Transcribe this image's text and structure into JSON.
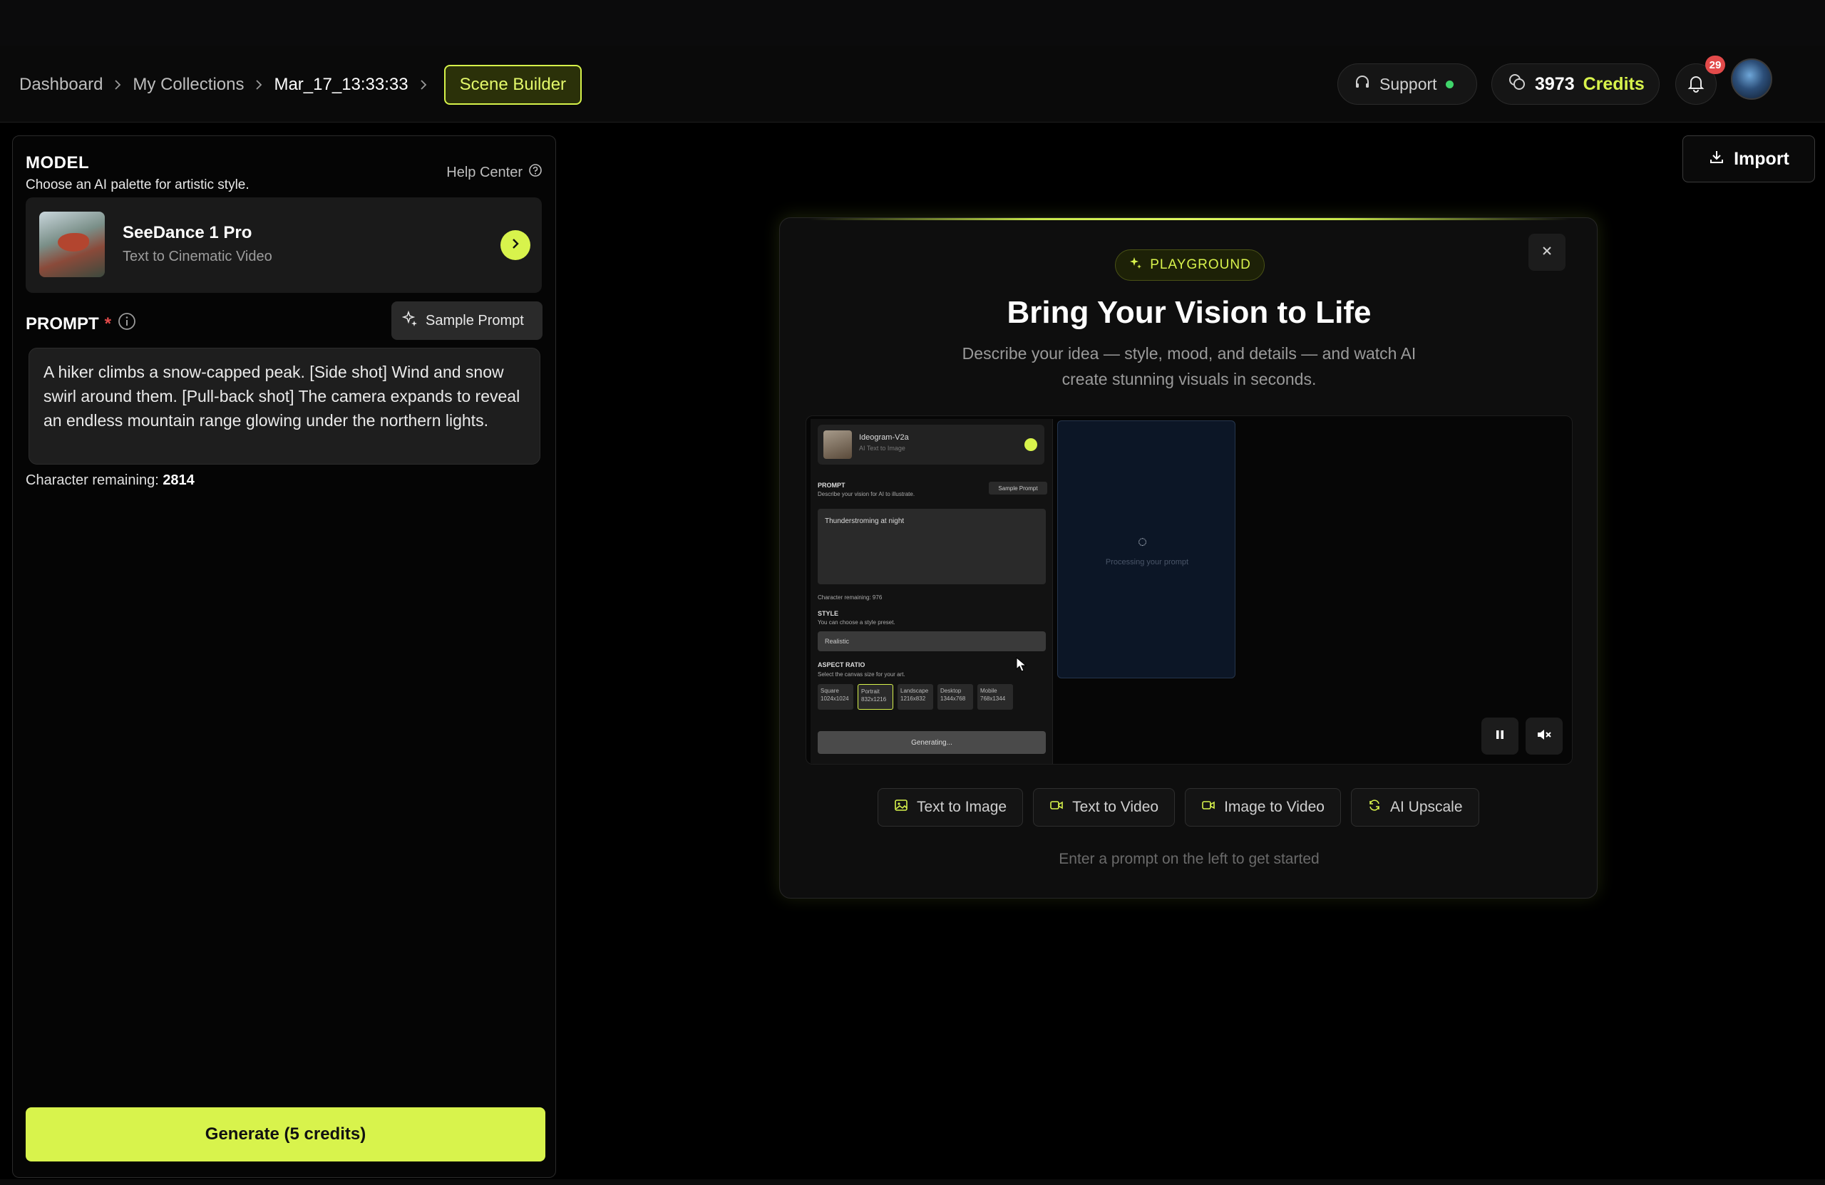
{
  "breadcrumb": {
    "items": [
      "Dashboard",
      "My Collections",
      "Mar_17_13:33:33"
    ],
    "scene_builder": "Scene Builder"
  },
  "header": {
    "support_label": "Support",
    "credits_value": "3973",
    "credits_word": "Credits",
    "notification_count": "29"
  },
  "model": {
    "title": "MODEL",
    "subtitle": "Choose an AI palette for artistic style.",
    "help_label": "Help Center",
    "name": "SeeDance 1 Pro",
    "description": "Text to Cinematic Video"
  },
  "prompt": {
    "title": "PROMPT",
    "required_mark": "*",
    "sample_label": "Sample Prompt",
    "value": "A hiker climbs a snow-capped peak. [Side shot] Wind and snow swirl around them. [Pull-back shot] The camera expands to reveal an endless mountain range glowing under the northern lights.",
    "chars_label": "Character remaining:",
    "chars_value": "2814"
  },
  "generate_label": "Generate (5 credits)",
  "import_label": "Import",
  "playground": {
    "badge": "PLAYGROUND",
    "title": "Bring Your Vision to Life",
    "subtitle": "Describe your idea — style, mood, and details — and watch AI create stunning visuals in seconds.",
    "tabs": [
      {
        "label": "Text to Image",
        "icon": "image-icon"
      },
      {
        "label": "Text to Video",
        "icon": "video-icon"
      },
      {
        "label": "Image to Video",
        "icon": "video-icon"
      },
      {
        "label": "AI Upscale",
        "icon": "refresh-icon"
      }
    ],
    "hint": "Enter a prompt on the left to get started"
  },
  "demo": {
    "model_name": "Ideogram-V2a",
    "model_desc": "AI Text to Image",
    "prompt_label": "PROMPT",
    "prompt_desc": "Describe your vision for AI to illustrate.",
    "sample_label": "Sample Prompt",
    "prompt_text": "Thunderstroming at night",
    "chars": "Character remaining: 976",
    "style_label": "STYLE",
    "style_desc": "You can choose a style preset.",
    "style_value": "Realistic",
    "ratio_label": "ASPECT RATIO",
    "ratio_desc": "Select the canvas size for your art.",
    "ratios": [
      {
        "name": "Square",
        "size": "1024x1024"
      },
      {
        "name": "Portrait",
        "size": "832x1216"
      },
      {
        "name": "Landscape",
        "size": "1216x832"
      },
      {
        "name": "Desktop",
        "size": "1344x768"
      },
      {
        "name": "Mobile",
        "size": "768x1344"
      }
    ],
    "generating": "Generating...",
    "processing": "Processing your prompt"
  },
  "colors": {
    "accent": "#d8f34c",
    "badge_red": "#e24a4a",
    "online_green": "#3fd46a"
  }
}
